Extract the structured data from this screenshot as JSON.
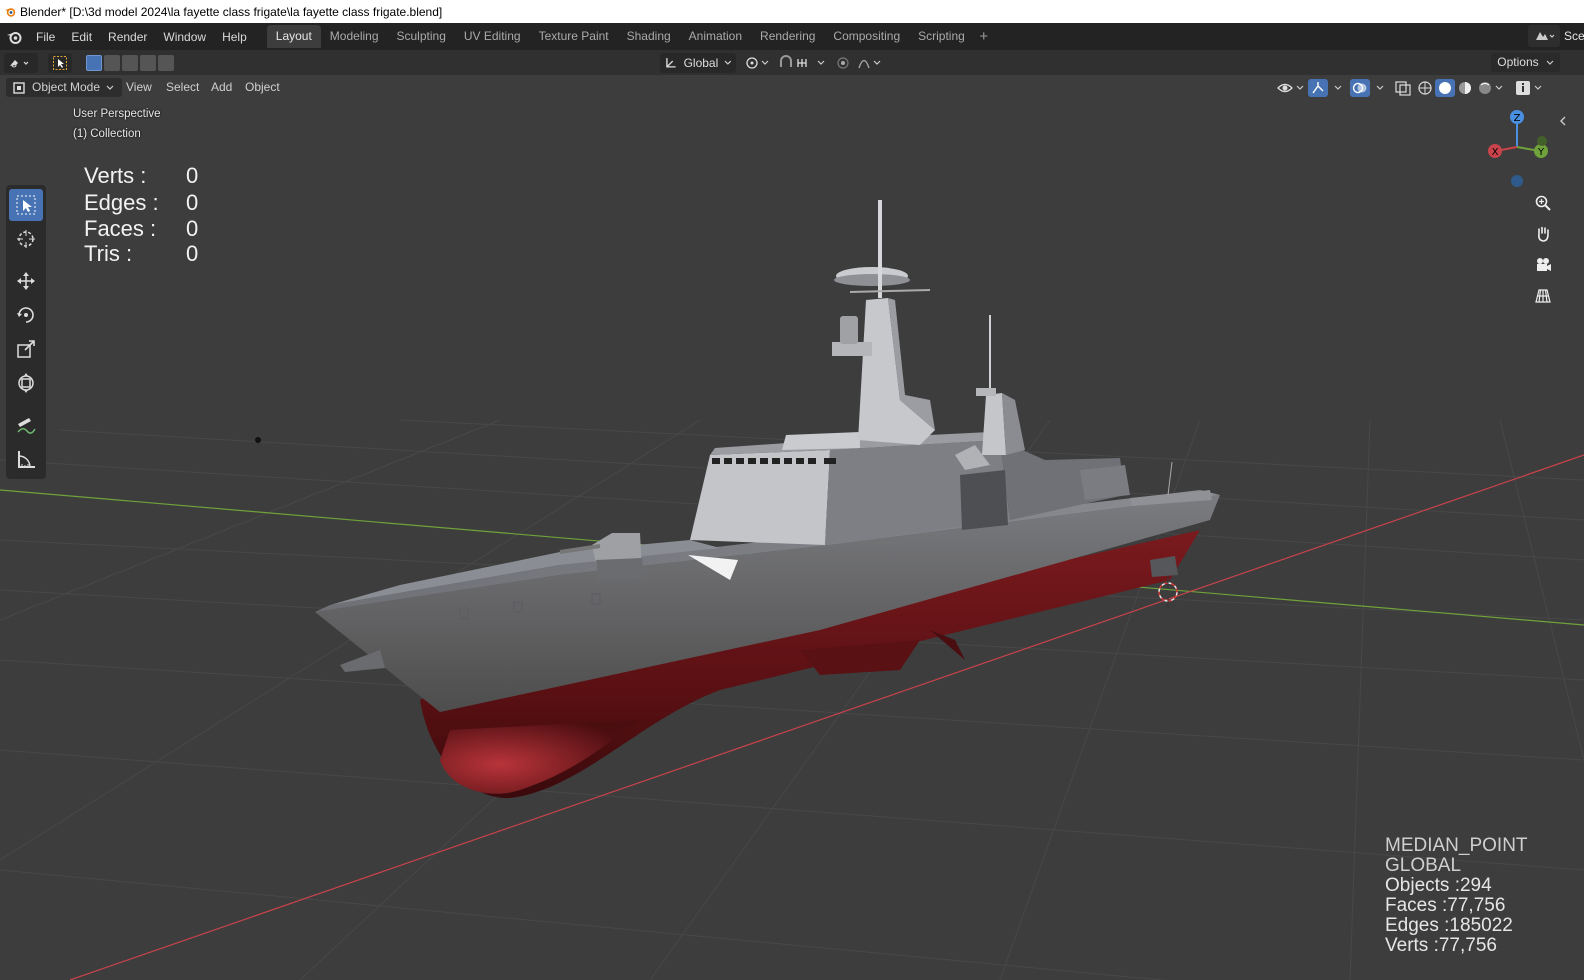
{
  "window": {
    "title": "Blender* [D:\\3d model 2024\\la fayette class frigate\\la fayette class frigate.blend]"
  },
  "menu": {
    "items": [
      "File",
      "Edit",
      "Render",
      "Window",
      "Help"
    ]
  },
  "workspaces": {
    "tabs": [
      "Layout",
      "Modeling",
      "Sculpting",
      "UV Editing",
      "Texture Paint",
      "Shading",
      "Animation",
      "Rendering",
      "Compositing",
      "Scripting"
    ],
    "active": "Layout",
    "add_label": "+"
  },
  "scene": {
    "label": "Scen"
  },
  "tool_header": {
    "orientation": "Global",
    "options_label": "Options"
  },
  "viewport_header": {
    "mode": "Object Mode",
    "menus": [
      "View",
      "Select",
      "Add",
      "Object"
    ]
  },
  "viewport_info": {
    "perspective": "User Perspective",
    "collection": "(1) Collection"
  },
  "selection_stats": [
    {
      "label": "Verts :",
      "value": "0"
    },
    {
      "label": "Edges :",
      "value": "0"
    },
    {
      "label": "Faces :",
      "value": "0"
    },
    {
      "label": "Tris :",
      "value": "0"
    }
  ],
  "scene_stats": {
    "pivot": "MEDIAN_POINT",
    "orientation": "GLOBAL",
    "objects": "Objects :294",
    "faces": "Faces :77,756",
    "edges": "Edges :185022",
    "verts": "Verts :77,756"
  },
  "gizmo": {
    "z": "Z",
    "y": "Y",
    "x": "X"
  },
  "colors": {
    "accent": "#4772b3",
    "viewport_bg": "#3d3d3d",
    "grid": "#474747",
    "axis_x": "#c8434a",
    "axis_y": "#6fa23a",
    "hull_red": "#6e1418",
    "hull_grey": "#6c6c6e",
    "superstructure": "#bdbfc3"
  }
}
